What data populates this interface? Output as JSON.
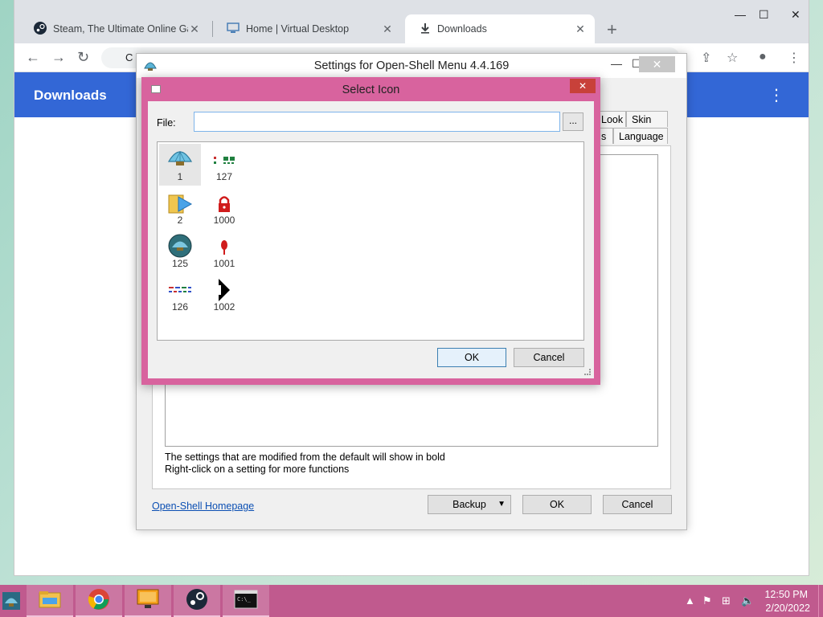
{
  "browser": {
    "tabs": [
      {
        "title": "Steam, The Ultimate Online Gam",
        "icon": "steam-icon"
      },
      {
        "title": "Home | Virtual Desktop",
        "icon": "monitor-icon"
      },
      {
        "title": "Downloads",
        "icon": "download-icon"
      }
    ],
    "omnibox_text": "C",
    "page_title": "Downloads"
  },
  "settings": {
    "title": "Settings for Open-Shell Menu 4.4.169",
    "tabs": [
      "Look",
      "Skin",
      "s",
      "Language"
    ],
    "note_line1": "The settings that are modified from the default will show in bold",
    "note_line2": "Right-click on a setting for more functions",
    "homepage_link": "Open-Shell Homepage",
    "backup_button": "Backup",
    "ok_button": "OK",
    "cancel_button": "Cancel"
  },
  "select_icon": {
    "title": "Select Icon",
    "file_label": "File:",
    "file_value": "",
    "browse_label": "...",
    "icons": [
      {
        "id": "1",
        "name": "shell-icon"
      },
      {
        "id": "2",
        "name": "folder-shortcut-icon"
      },
      {
        "id": "125",
        "name": "shell-round-icon"
      },
      {
        "id": "126",
        "name": "dashed-lines-icon"
      },
      {
        "id": "127",
        "name": "green-dots-icon"
      },
      {
        "id": "1000",
        "name": "padlock-icon"
      },
      {
        "id": "1001",
        "name": "red-pin-icon"
      },
      {
        "id": "1002",
        "name": "arrow-cursor-icon"
      }
    ],
    "selected": "1",
    "ok_label": "OK",
    "cancel_label": "Cancel"
  },
  "taskbar": {
    "apps": [
      "file-explorer-icon",
      "chrome-icon",
      "monitor-icon",
      "steam-icon",
      "command-prompt-icon"
    ],
    "time": "12:50 PM",
    "date": "2/20/2022"
  }
}
